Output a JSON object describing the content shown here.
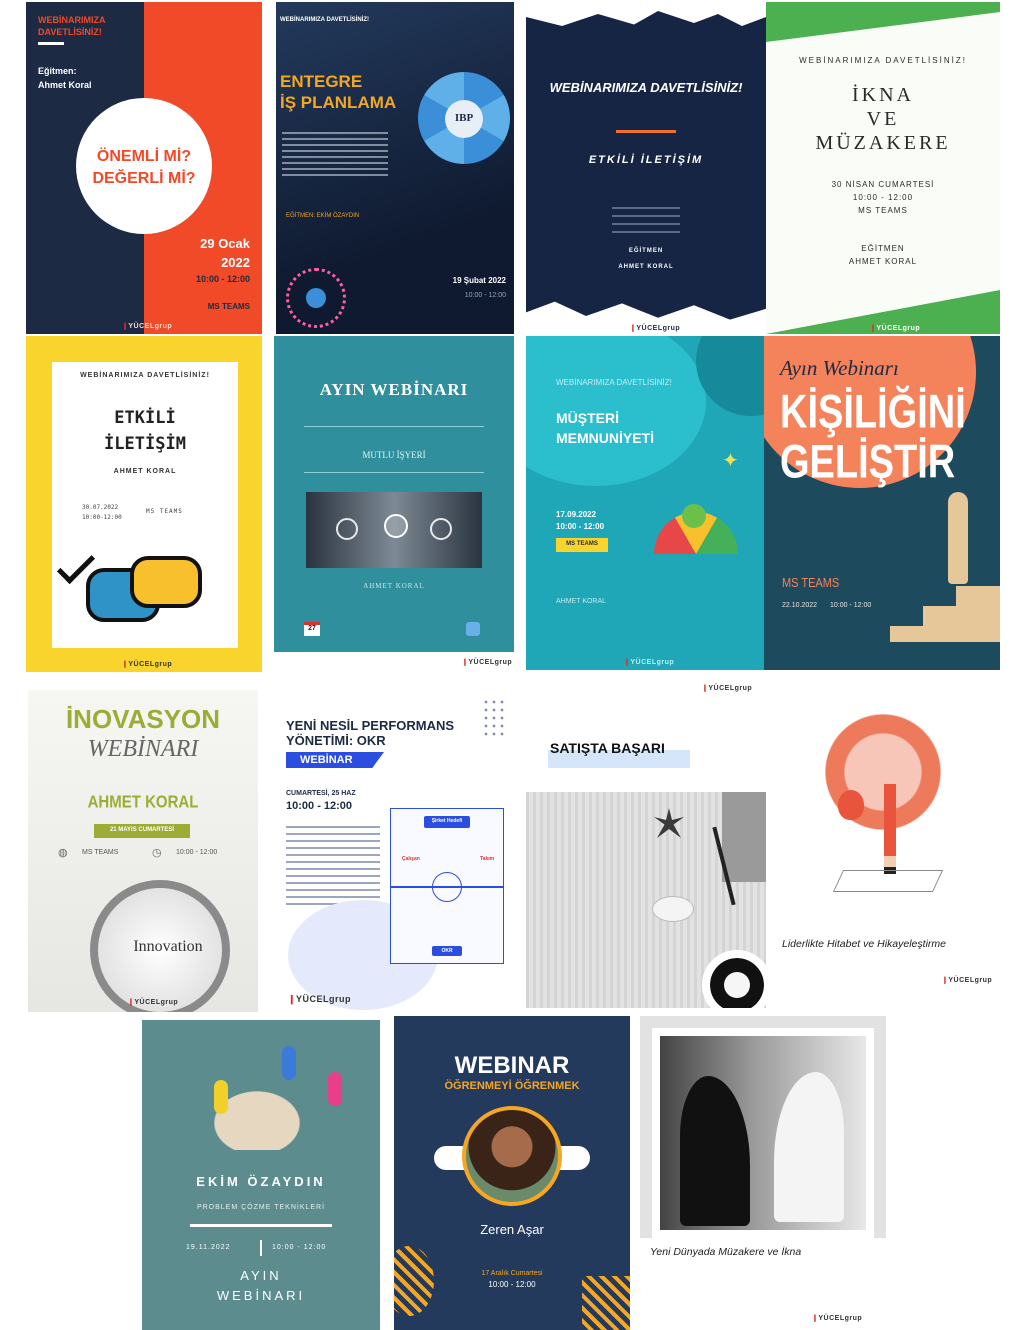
{
  "brand": {
    "logo_text": "YÜCELgrup"
  },
  "colors": {
    "navy": "#1d2a44",
    "orange_red": "#f04a28",
    "teal": "#2f8f9d",
    "yellow": "#f8d42c",
    "orange": "#f5a45c",
    "blue_band": "#2c4ee0"
  },
  "posters": {
    "p1": {
      "header": "WEBİNARIMIZA DAVETLİSİNİZ!",
      "trainer_label": "Eğitmen:",
      "trainer": "Ahmet Koral",
      "circle_line1": "ÖNEMLİ Mİ?",
      "circle_line2": "DEĞERLİ Mİ?",
      "day": "29 Ocak",
      "year": "2022",
      "time": "10:00 - 12:00",
      "platform": "MS TEAMS"
    },
    "p2": {
      "header": "WEBİNARIMIZA DAVETLİSİNİZ!",
      "title1": "ENTEGRE",
      "title2": "İŞ PLANLAMA",
      "badge": "IBP",
      "trainer": "EĞİTMEN: EKİM ÖZAYDIN",
      "date": "19 Şubat 2022",
      "time": "10:00 - 12:00"
    },
    "p3": {
      "title": "WEBİNARIMIZA DAVETLİSİNİZ!",
      "subtitle": "ETKİLİ İLETİŞİM",
      "trainer_label": "EĞİTMEN",
      "trainer": "AHMET KORAL"
    },
    "p4": {
      "header": "WEBİNARIMIZA DAVETLİSİNİZ!",
      "title1": "İKNA",
      "title2": "VE",
      "title3": "MÜZAKERE",
      "date": "30 NİSAN CUMARTESİ",
      "time": "10:00 - 12:00",
      "platform": "MS TEAMS",
      "trainer_label": "EĞİTMEN",
      "trainer": "AHMET KORAL"
    },
    "p5": {
      "header": "WEBİNARIMIZA DAVETLİSİNİZ!",
      "title1": "ETKİLİ",
      "title2": "İLETİŞİM",
      "trainer": "AHMET KORAL",
      "date": "30.07.2022",
      "time": "10:00-12:00",
      "platform": "MS TEAMS"
    },
    "p6": {
      "title": "AYIN WEBİNARI",
      "subtitle": "MUTLU İŞYERİ",
      "trainer": "AHMET KORAL",
      "day": "27"
    },
    "p7": {
      "header": "WEBİNARIMIZA DAVETLİSİNİZ!",
      "title1": "MÜŞTERİ",
      "title2": "MEMNUNİYETİ",
      "date": "17.09.2022",
      "time": "10:00 - 12:00",
      "platform": "MS TEAMS",
      "trainer": "AHMET KORAL"
    },
    "p8": {
      "script": "Ayın Webinarı",
      "title1": "KİŞİLİĞİNİ",
      "title2": "GELİŞTİR",
      "platform": "MS TEAMS",
      "date": "22.10.2022",
      "time": "10:00 - 12:00"
    },
    "p9": {
      "title1": "İNOVASYON",
      "title2": "WEBİNARI",
      "trainer": "AHMET KORAL",
      "date": "21 MAYIS CUMARTESİ",
      "platform": "MS TEAMS",
      "time": "10:00 - 12:00",
      "lens_word": "Innovation"
    },
    "p10": {
      "title1": "YENİ NESİL PERFORMANS",
      "title2": "YÖNETİMİ: OKR",
      "band": "WEBİNAR",
      "date": "CUMARTESİ, 25 HAZ",
      "time": "10:00 - 12:00",
      "field_top": "Şirket Hedefi",
      "field_left": "Çalışan",
      "field_right": "Takım",
      "field_bottom": "OKR"
    },
    "p11": {
      "title": "SATIŞTA BAŞARI"
    },
    "p12": {
      "caption": "Liderlikte Hitabet ve Hikayeleştirme"
    },
    "p13": {
      "trainer": "EKİM ÖZAYDIN",
      "subtitle": "PROBLEM ÇÖZME TEKNİKLERİ",
      "date": "19.11.2022",
      "time": "10:00 - 12:00",
      "footer1": "AYIN",
      "footer2": "WEBİNARI"
    },
    "p14": {
      "title": "WEBINAR",
      "subtitle": "ÖĞRENMEYİ ÖĞRENMEK",
      "trainer": "Zeren Aşar",
      "date": "17 Aralık Cumartesi",
      "time": "10:00 - 12:00"
    },
    "p15": {
      "caption": "Yeni Dünyada Müzakere ve İkna"
    }
  }
}
